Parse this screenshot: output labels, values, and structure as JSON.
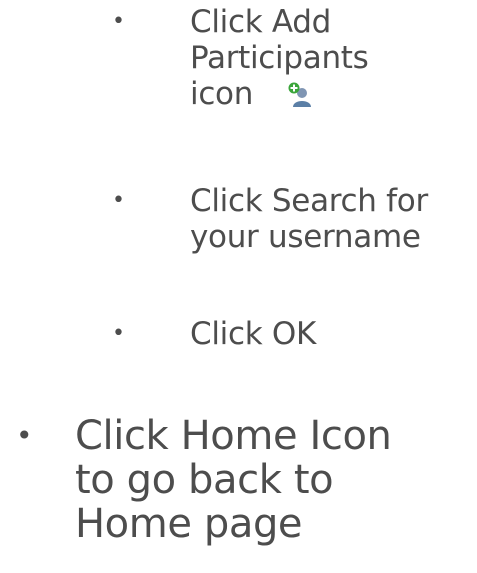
{
  "steps": [
    {
      "line1": "Click Add",
      "line2": "Participants",
      "line3": "icon",
      "icon": "add-participant-icon"
    },
    {
      "line1": "Click Search for",
      "line2": "your username"
    },
    {
      "line1": "Click OK"
    }
  ],
  "main_step": {
    "line1": "Click Home Icon",
    "line2": "to go back to",
    "line3": "Home page"
  },
  "bullet_char": "•",
  "colors": {
    "text": "#4d4d4d",
    "icon_plus": "#3aa53a",
    "icon_person": "#5b7fa6"
  }
}
